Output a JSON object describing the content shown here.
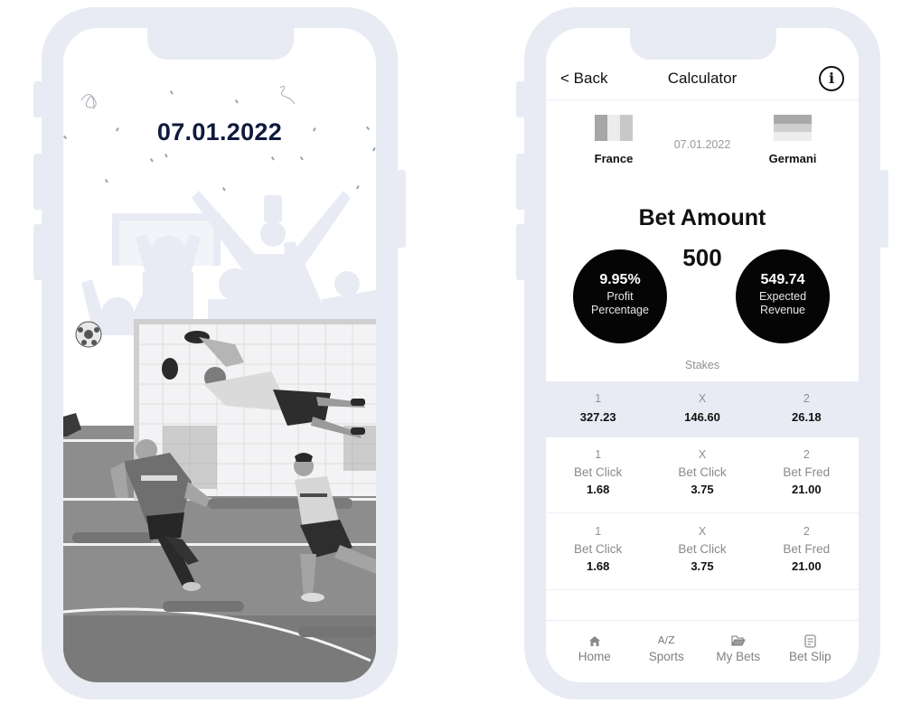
{
  "splash": {
    "date": "07.01.2022"
  },
  "calculator": {
    "header": {
      "back_label": "< Back",
      "title": "Calculator",
      "info_icon": "i"
    },
    "match": {
      "home_team": "France",
      "away_team": "Germani",
      "date": "07.01.2022",
      "home_flag_colors": [
        "#a6a6a6",
        "#ececec",
        "#c8c8c8"
      ],
      "away_flag_colors": [
        "#a9a9a9",
        "#cfcfcf",
        "#ededed"
      ]
    },
    "bet_amount": {
      "title": "Bet Amount",
      "value": "500"
    },
    "profit": {
      "value": "9.95%",
      "label": "Profit Percentage"
    },
    "revenue": {
      "value": "549.74",
      "label": "Expected Revenue"
    },
    "stakes": {
      "label": "Stakes",
      "cells": [
        {
          "outcome": "1",
          "value": "327.23"
        },
        {
          "outcome": "X",
          "value": "146.60"
        },
        {
          "outcome": "2",
          "value": "26.18"
        }
      ]
    },
    "odds_rows": [
      [
        {
          "outcome": "1",
          "bookmaker": "Bet Click",
          "odd": "1.68"
        },
        {
          "outcome": "X",
          "bookmaker": "Bet Click",
          "odd": "3.75"
        },
        {
          "outcome": "2",
          "bookmaker": "Bet Fred",
          "odd": "21.00"
        }
      ],
      [
        {
          "outcome": "1",
          "bookmaker": "Bet Click",
          "odd": "1.68"
        },
        {
          "outcome": "X",
          "bookmaker": "Bet Click",
          "odd": "3.75"
        },
        {
          "outcome": "2",
          "bookmaker": "Bet Fred",
          "odd": "21.00"
        }
      ]
    ],
    "tabbar": [
      {
        "label": "Home",
        "icon": "home-icon"
      },
      {
        "label": "Sports",
        "icon": "az-icon",
        "glyph": "A/Z"
      },
      {
        "label": "My Bets",
        "icon": "folder-icon"
      },
      {
        "label": "Bet Slip",
        "icon": "receipt-icon"
      }
    ]
  }
}
